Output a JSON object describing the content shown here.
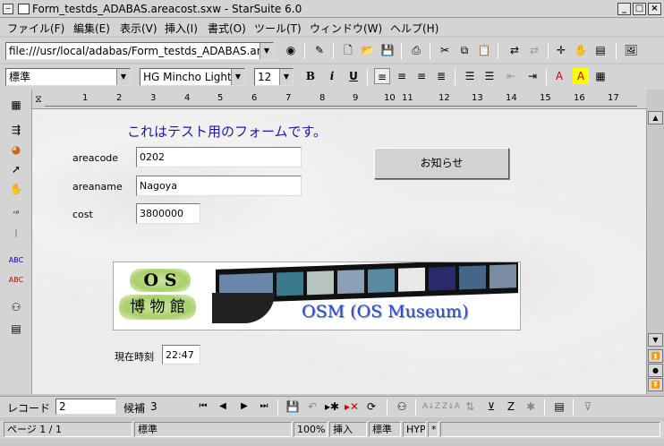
{
  "window": {
    "title": "Form_testds_ADABAS.areacost.sxw - StarSuite 6.0",
    "min": "_",
    "max": "□",
    "close": "×"
  },
  "menu": [
    "ファイル(F)",
    "編集(E)",
    "表示(V)",
    "挿入(I)",
    "書式(O)",
    "ツール(T)",
    "ウィンドウ(W)",
    "ヘルプ(H)"
  ],
  "toolbar": {
    "url": "file:///usr/local/adabas/Form_testds_ADABAS.areac"
  },
  "format": {
    "style": "標準",
    "font": "HG Mincho Light J",
    "size": "12",
    "bold": "B",
    "italic": "i",
    "underline": "U"
  },
  "ruler": {
    "ticks": [
      "1",
      "2",
      "3",
      "4",
      "5",
      "6",
      "7",
      "8",
      "9",
      "10",
      "11",
      "12",
      "13",
      "14",
      "15",
      "16",
      "17"
    ]
  },
  "form": {
    "heading": "これはテスト用のフォームです。",
    "fields": [
      {
        "label": "areacode",
        "value": "0202"
      },
      {
        "label": "areaname",
        "value": "Nagoya"
      },
      {
        "label": "cost",
        "value": "3800000"
      }
    ],
    "notice_button": "お知らせ",
    "banner": {
      "os_letters": "O S",
      "kanji": "博 物 館",
      "caption": "OSM (OS Museum)"
    },
    "time_label": "現在時刻",
    "time_value": "22:47"
  },
  "nav": {
    "record_label": "レコード",
    "record_value": "2",
    "candidate_label": "候補",
    "candidate_count": "3"
  },
  "status": {
    "page": "ページ 1 / 1",
    "style": "標準",
    "zoom": "100%",
    "insert": "挿入",
    "mode": "標準",
    "hyp": "HYP",
    "star": "*"
  }
}
